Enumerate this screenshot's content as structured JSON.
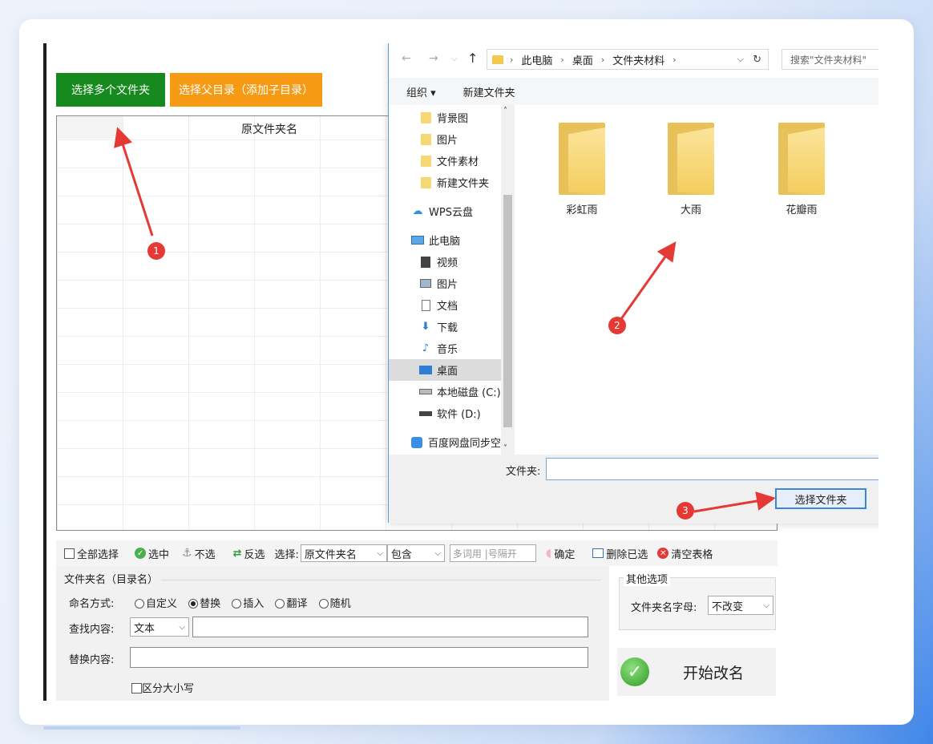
{
  "main": {
    "btn_select_multi": "选择多个文件夹",
    "btn_select_parent": "选择父目录（添加子目录）",
    "grid_header": "原文件夹名"
  },
  "toolbar": {
    "select_all": "全部选择",
    "check": "选中",
    "uncheck": "不选",
    "invert": "反选",
    "select_label": "选择:",
    "field_value": "原文件夹名",
    "match_value": "包含",
    "keyword_placeholder": "多词用 |号隔开",
    "confirm": "确定",
    "delete_selected": "删除已选",
    "clear_table": "清空表格"
  },
  "naming": {
    "section_title": "文件夹名（目录名）",
    "mode_label": "命名方式:",
    "modes": [
      "自定义",
      "替换",
      "插入",
      "翻译",
      "随机"
    ],
    "selected_mode": "替换",
    "find_label": "查找内容:",
    "find_type": "文本",
    "replace_label": "替换内容:",
    "case_sensitive": "区分大小写"
  },
  "other": {
    "title": "其他选项",
    "letter_label": "文件夹名字母:",
    "letter_value": "不改变",
    "start_label": "开始改名"
  },
  "dialog": {
    "breadcrumb": [
      "此电脑",
      "桌面",
      "文件夹材料"
    ],
    "search_placeholder": "搜索\"文件夹材料\"",
    "organize": "组织 ▾",
    "new_folder": "新建文件夹",
    "nav": [
      {
        "label": "背景图",
        "icon": "folder-icon"
      },
      {
        "label": "图片",
        "icon": "folder-icon"
      },
      {
        "label": "文件素材",
        "icon": "folder-icon"
      },
      {
        "label": "新建文件夹",
        "icon": "folder-icon"
      },
      {
        "label": "WPS云盘",
        "icon": "cloud-icon"
      },
      {
        "label": "此电脑",
        "icon": "computer-icon"
      },
      {
        "label": "视频",
        "icon": "video-icon"
      },
      {
        "label": "图片",
        "icon": "pictures-icon"
      },
      {
        "label": "文档",
        "icon": "documents-icon"
      },
      {
        "label": "下载",
        "icon": "download-icon"
      },
      {
        "label": "音乐",
        "icon": "music-icon"
      },
      {
        "label": "桌面",
        "icon": "desktop-icon"
      },
      {
        "label": "本地磁盘 (C:)",
        "icon": "drive-icon"
      },
      {
        "label": "软件 (D:)",
        "icon": "drive-icon"
      },
      {
        "label": "百度网盘同步空",
        "icon": "baidu-icon"
      }
    ],
    "folders": [
      "彩虹雨",
      "大雨",
      "花瓣雨"
    ],
    "filename_label": "文件夹:",
    "select_folder_button": "选择文件夹"
  },
  "annotations": [
    "1",
    "2",
    "3"
  ],
  "colors": {
    "green_button": "#168a1e",
    "orange_button": "#f59a12",
    "annotation_red": "#e53935",
    "folder_yellow": "#f4cd5e"
  }
}
